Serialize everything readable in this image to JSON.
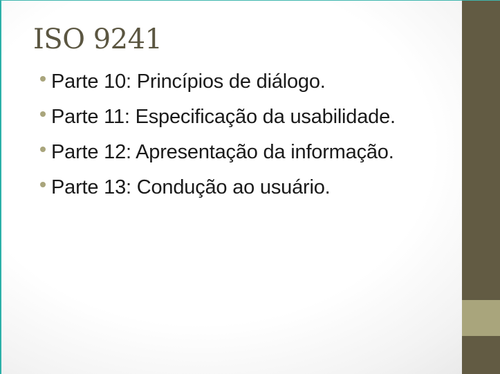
{
  "slide": {
    "title": "ISO 9241",
    "bullets": [
      {
        "text": "Parte 10: Princípios de diálogo."
      },
      {
        "text": "Parte 11: Especificação da usabilidade."
      },
      {
        "text": "Parte 12: Apresentação da informação."
      },
      {
        "text": "Parte 13: Condução ao usuário."
      }
    ]
  },
  "colors": {
    "title": "#5b5641",
    "side_bar": "#625b43",
    "side_accent": "#a9a57c",
    "bullet": "#a9a57c",
    "body_text": "#1a1a1a",
    "left_edge": "#2bb0a8"
  }
}
